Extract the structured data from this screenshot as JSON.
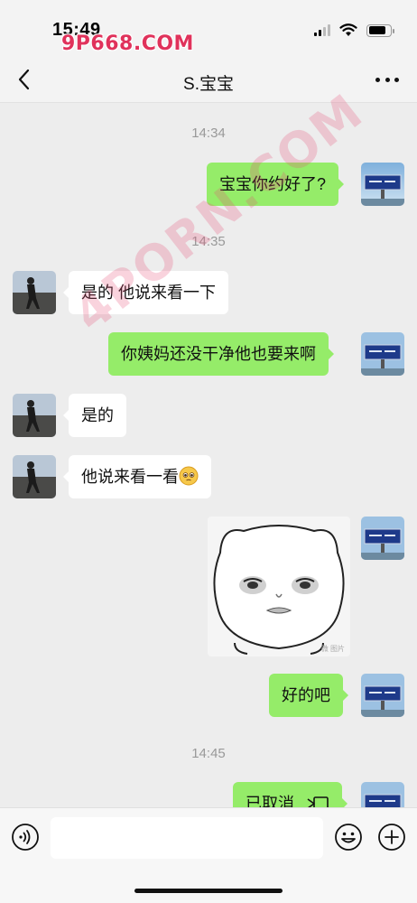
{
  "status_bar": {
    "time": "15:49",
    "watermark": "9P668.COM"
  },
  "header": {
    "title": "S.宝宝"
  },
  "watermark_diagonal": "4PORN.COM",
  "messages": {
    "ts1": "14:34",
    "m1": "宝宝你约好了?",
    "ts2": "14:35",
    "m2": "是的 他说来看一下",
    "m3": "你姨妈还没干净他也要来啊",
    "m4": "是的",
    "m5": "他说来看一看",
    "m6": "好的吧",
    "ts3": "14:45",
    "m7": "已取消",
    "sticker_caption": "微 图片"
  },
  "input_bar": {
    "placeholder": ""
  },
  "colors": {
    "outgoing_bubble": "#95ec69",
    "incoming_bubble": "#ffffff",
    "background": "#ededed"
  }
}
